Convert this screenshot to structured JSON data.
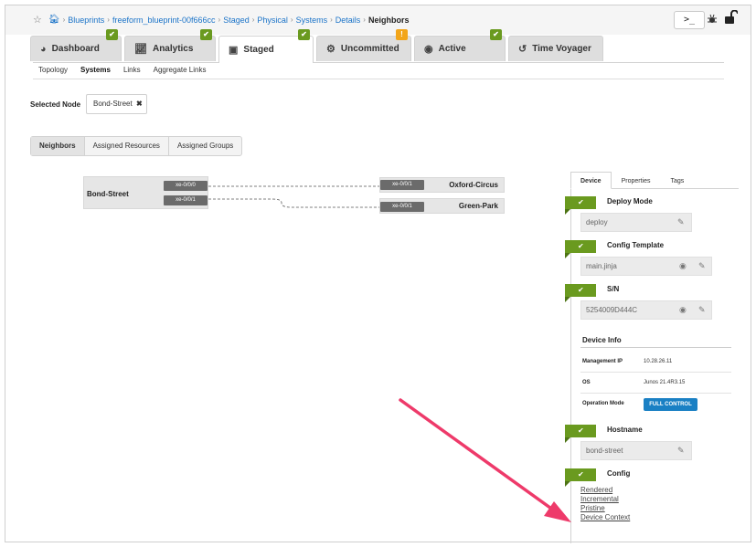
{
  "breadcrumb": {
    "items": [
      "Blueprints",
      "freeform_blueprint-00f666cc",
      "Staged",
      "Physical",
      "Systems",
      "Details"
    ],
    "current": "Neighbors"
  },
  "toolbar": {
    "cli_label": ">_"
  },
  "main_tabs": [
    {
      "label": "Dashboard",
      "badge": "✔",
      "icon": "dashboard-icon"
    },
    {
      "label": "Analytics",
      "badge": "✔",
      "icon": "chart-icon"
    },
    {
      "label": "Staged",
      "badge": "✔",
      "icon": "staged-icon",
      "active": true
    },
    {
      "label": "Uncommitted",
      "badge": "!",
      "icon": "uncommitted-icon"
    },
    {
      "label": "Active",
      "badge": "✔",
      "icon": "active-icon"
    },
    {
      "label": "Time Voyager",
      "icon": "history-icon"
    }
  ],
  "sub_tabs": [
    "Topology",
    "Systems",
    "Links",
    "Aggregate Links"
  ],
  "selected_node": {
    "label": "Selected Node",
    "value": "Bond-Street",
    "remove": "✖"
  },
  "segment_tabs": [
    "Neighbors",
    "Assigned Resources",
    "Assigned Groups"
  ],
  "topology": {
    "source": {
      "name": "Bond-Street",
      "ports": [
        "xe-0/0/0",
        "xe-0/0/1"
      ]
    },
    "neighbors": [
      {
        "name": "Oxford-Circus",
        "port": "xe-0/0/1"
      },
      {
        "name": "Green-Park",
        "port": "xe-0/0/1"
      }
    ]
  },
  "panel": {
    "tabs": [
      "Device",
      "Properties",
      "Tags"
    ],
    "deploy_mode": {
      "title": "Deploy Mode",
      "value": "deploy"
    },
    "config_template": {
      "title": "Config Template",
      "value": "main.jinja"
    },
    "sn": {
      "title": "S/N",
      "value": "5254009D444C"
    },
    "device_info": {
      "title": "Device Info",
      "management_ip_label": "Management IP",
      "management_ip": "10.28.26.11",
      "os_label": "OS",
      "os": "Junos 21.4R3.15",
      "operation_mode_label": "Operation Mode",
      "operation_mode": "FULL CONTROL"
    },
    "hostname": {
      "title": "Hostname",
      "value": "bond-street"
    },
    "config": {
      "title": "Config",
      "links": [
        "Rendered",
        "Incremental",
        "Pristine",
        "Device Context"
      ]
    },
    "check_glyph": "✔"
  },
  "colors": {
    "accent_green": "#6a9a1f",
    "warning": "#f2a51a",
    "primary_blue": "#1a80c4",
    "arrow": "#ee3a6a"
  }
}
